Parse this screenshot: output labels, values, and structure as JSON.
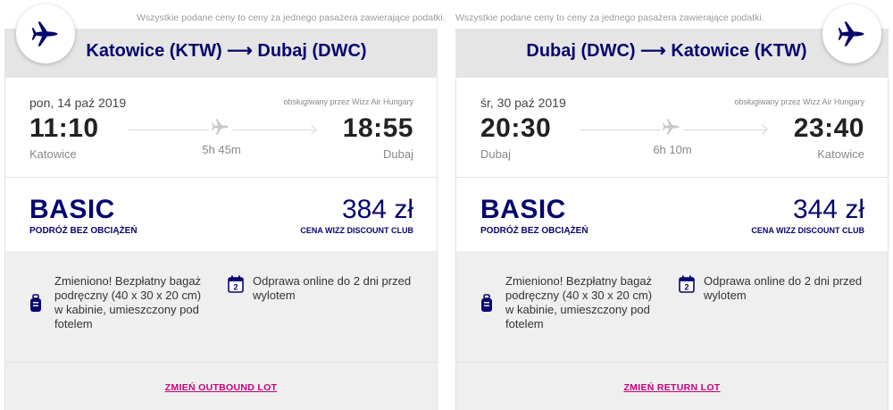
{
  "colors": {
    "brand_navy": "#06066e",
    "brand_pink": "#c6007e",
    "header_gray": "#e5e5e5"
  },
  "outbound": {
    "notice": "Wszystkie podane ceny to ceny za jednego pasażera zawierające podatki.",
    "route": "Katowice (KTW) ⟶ Dubaj (DWC)",
    "plane_icon": "plane-icon",
    "date": "pon, 14 paź 2019",
    "operated_by": "obsługiwany przez Wizz Air Hungary",
    "dep_time": "11:10",
    "arr_time": "18:55",
    "duration": "5h 45m",
    "dep_city": "Katowice",
    "arr_city": "Dubaj",
    "fare_name": "BASIC",
    "fare_desc": "PODRÓŻ BEZ OBCIĄŻEŃ",
    "price": "384 zł",
    "price_note": "CENA WIZZ DISCOUNT CLUB",
    "benefit_bag": "Zmieniono! Bezpłatny bagaż podręczny (40 x 30 x 20 cm) w kabinie, umieszczony pod fotelem",
    "benefit_checkin": "Odprawa online do 2 dni przed wylotem",
    "calendar_day": "2",
    "change_label": "ZMIEŃ OUTBOUND LOT"
  },
  "return": {
    "notice": "Wszystkie podane ceny to ceny za jednego pasażera zawierające podatki.",
    "route": "Dubaj (DWC) ⟶ Katowice (KTW)",
    "plane_icon": "plane-icon",
    "date": "śr, 30 paź 2019",
    "operated_by": "obsługiwany przez Wizz Air Hungary",
    "dep_time": "20:30",
    "arr_time": "23:40",
    "duration": "6h 10m",
    "dep_city": "Dubaj",
    "arr_city": "Katowice",
    "fare_name": "BASIC",
    "fare_desc": "PODRÓŻ BEZ OBCIĄŻEŃ",
    "price": "344 zł",
    "price_note": "CENA WIZZ DISCOUNT CLUB",
    "benefit_bag": "Zmieniono! Bezpłatny bagaż podręczny (40 x 30 x 20 cm) w kabinie, umieszczony pod fotelem",
    "benefit_checkin": "Odprawa online do 2 dni przed wylotem",
    "calendar_day": "2",
    "change_label": "ZMIEŃ RETURN LOT"
  }
}
